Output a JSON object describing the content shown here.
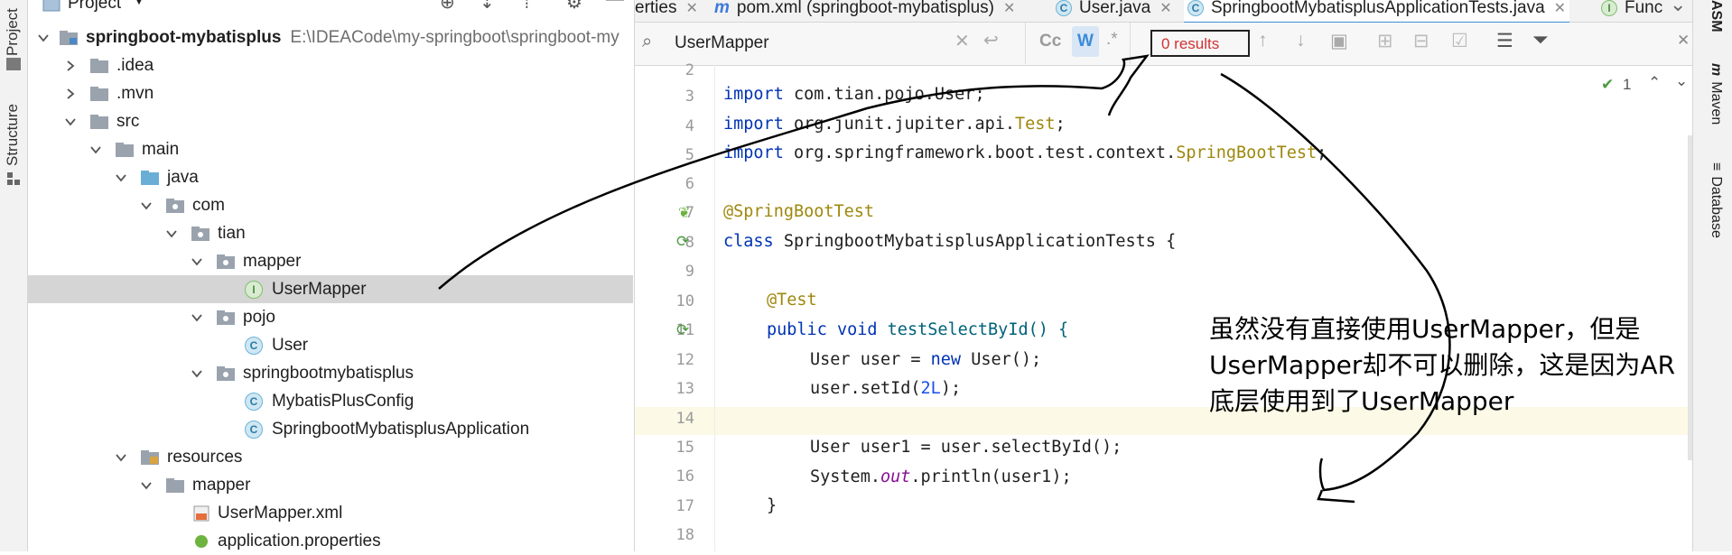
{
  "left_strip": {
    "tabs": [
      "Project",
      "Structure"
    ]
  },
  "project_panel": {
    "title": "Project",
    "root": {
      "name": "springboot-mybatisplus",
      "path": "E:\\IDEACode\\my-springboot\\springboot-my"
    },
    "tree": [
      {
        "label": ".idea",
        "type": "folder"
      },
      {
        "label": ".mvn",
        "type": "folder"
      },
      {
        "label": "src",
        "type": "folder"
      },
      {
        "label": "main",
        "type": "folder"
      },
      {
        "label": "java",
        "type": "folder"
      },
      {
        "label": "com",
        "type": "package"
      },
      {
        "label": "tian",
        "type": "package"
      },
      {
        "label": "mapper",
        "type": "package"
      },
      {
        "label": "UserMapper",
        "type": "interface"
      },
      {
        "label": "pojo",
        "type": "package"
      },
      {
        "label": "User",
        "type": "class"
      },
      {
        "label": "springbootmybatisplus",
        "type": "package"
      },
      {
        "label": "MybatisPlusConfig",
        "type": "class"
      },
      {
        "label": "SpringbootMybatisplusApplication",
        "type": "class"
      },
      {
        "label": "resources",
        "type": "folder"
      },
      {
        "label": "mapper",
        "type": "folder"
      },
      {
        "label": "UserMapper.xml",
        "type": "xml"
      },
      {
        "label": "application.properties",
        "type": "properties"
      }
    ]
  },
  "editor": {
    "tabs": [
      {
        "label": "erties",
        "icon": ""
      },
      {
        "label": "pom.xml (springboot-mybatisplus)",
        "icon": "m"
      },
      {
        "label": "User.java",
        "icon": "C"
      },
      {
        "label": "SpringbootMybatisplusApplicationTests.java",
        "icon": "C"
      },
      {
        "label": "Func",
        "icon": "I"
      }
    ],
    "search": {
      "value": "UserMapper",
      "results": "0 results",
      "case_label": "Cc",
      "word_label": "W",
      "regex_label": ".*"
    },
    "inspections": {
      "count": "1"
    },
    "line_numbers": [
      "2",
      "3",
      "4",
      "5",
      "6",
      "7",
      "8",
      "9",
      "10",
      "11",
      "12",
      "13",
      "14",
      "15",
      "16",
      "17",
      "18"
    ],
    "code": {
      "l3a": "import",
      "l3b": " com.tian.pojo.User;",
      "l4a": "import",
      "l4b": " org.junit.jupiter.api.",
      "l4c": "Test",
      "l4d": ";",
      "l5a": "import",
      "l5b": " org.springframework.boot.test.context.",
      "l5c": "SpringBootTest",
      "l5d": ";",
      "l7": "@SpringBootTest",
      "l8a": "class",
      "l8b": " SpringbootMybatisplusApplicationTests {",
      "l10": "@Test",
      "l11a": "public",
      "l11b": " ",
      "l11c": "void",
      "l11d": " testSelectById() {",
      "l12a": "User user = ",
      "l12b": "new",
      "l12c": " User();",
      "l13a": "user.setId(",
      "l13b": "2L",
      "l13c": ");",
      "l15": "User user1 = user.selectById();",
      "l16a": "System.",
      "l16b": "out",
      "l16c": ".println(user1);",
      "l17": "}"
    }
  },
  "right_strip": {
    "tabs": [
      "ASM",
      "Maven",
      "Database"
    ]
  },
  "annotation": {
    "lines": [
      "虽然没有直接使用UserMapper，但是",
      "UserMapper却不可以删除，这是因为AR",
      "底层使用到了UserMapper"
    ]
  }
}
